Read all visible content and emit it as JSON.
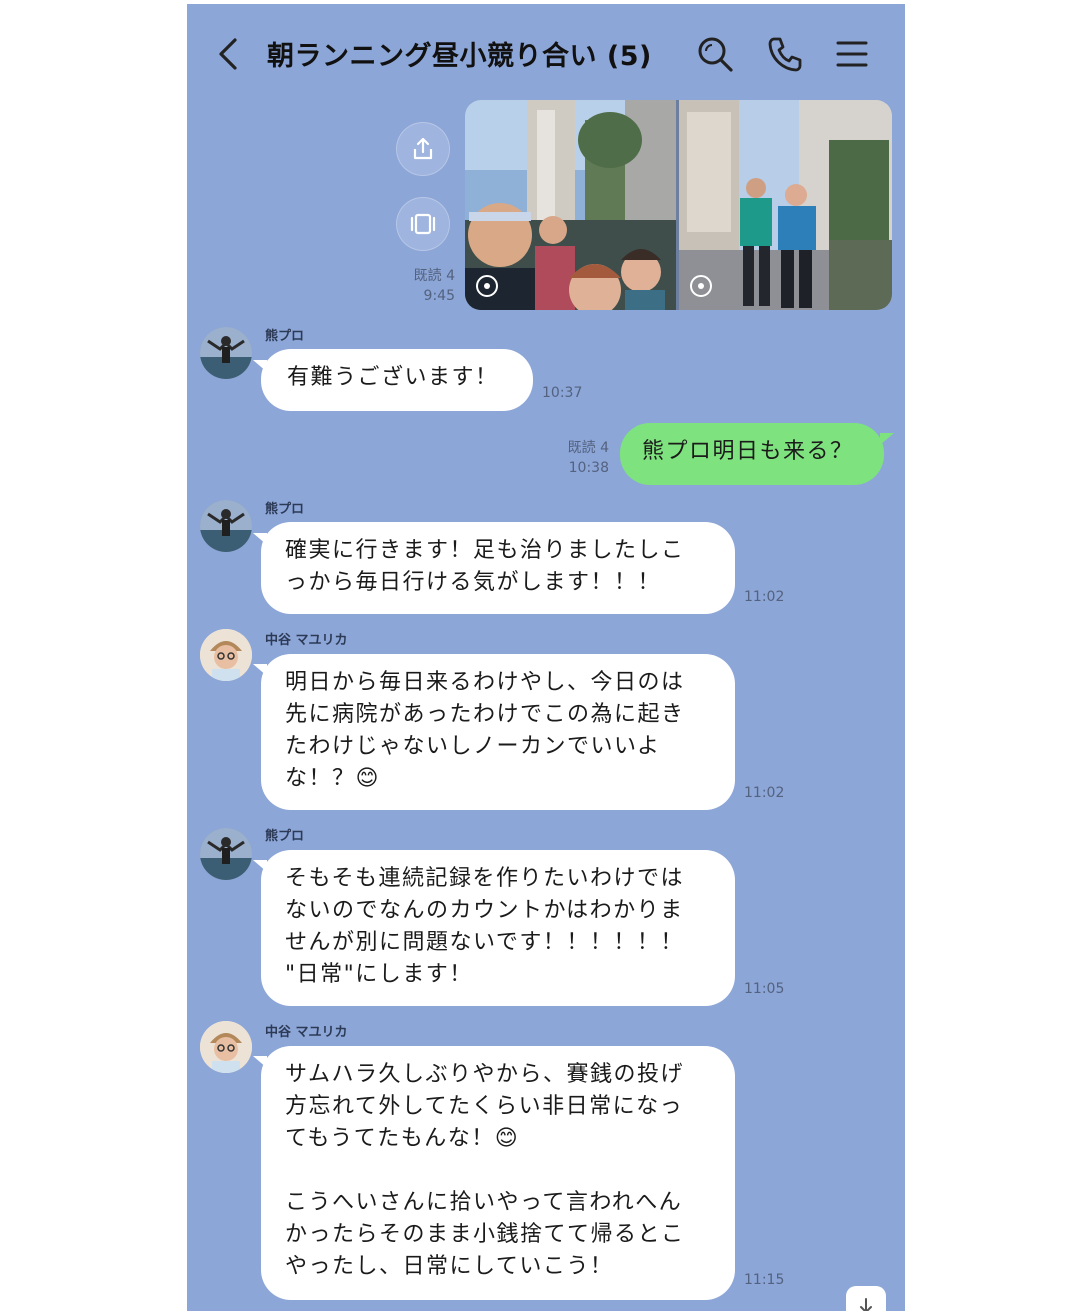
{
  "header": {
    "title": "朝ランニング昼小競り合い (5)"
  },
  "colors": {
    "chat_background": "#8da6d8",
    "outgoing_bubble": "#7ee27e",
    "incoming_bubble": "#ffffff"
  },
  "icons": {
    "back": "chevron-left-icon",
    "search": "search-icon",
    "call": "phone-icon",
    "menu": "hamburger-menu-icon",
    "share": "share-icon",
    "slideshow": "slideshow-icon",
    "scroll_down": "arrow-down-icon"
  },
  "photo_message": {
    "read_status": "既読 4",
    "time": "9:45"
  },
  "messages": [
    {
      "sender": "熊プロ",
      "text": "有難うございます！",
      "time": "10:37"
    },
    {
      "read_status": "既読 4",
      "time": "10:38",
      "text": "熊プロ明日も来る？"
    },
    {
      "sender": "熊プロ",
      "text": "確実に行きます！足も治りましたしこ\nっから毎日行ける気がします！！！",
      "time": "11:02"
    },
    {
      "sender": "中谷 マユリカ",
      "text": "明日から毎日来るわけやし、今日のは\n先に病院があったわけでこの為に起き\nたわけじゃないしノーカンでいいよ\nな！？😊",
      "time": "11:02"
    },
    {
      "sender": "熊プロ",
      "text": "そもそも連続記録を作りたいわけでは\nないのでなんのカウントかはわかりま\nせんが別に問題ないです！！！！！！\n\"日常\"にします！",
      "time": "11:05"
    },
    {
      "sender": "中谷 マユリカ",
      "text": "サムハラ久しぶりやから、賽銭の投げ\n方忘れて外してたくらい非日常になっ\nてもうてたもんな！😊\n\nこうへいさんに拾いやって言われへん\nかったらそのまま小銭捨てて帰るとこ\nやったし、日常にしていこう！",
      "time": "11:15"
    }
  ]
}
